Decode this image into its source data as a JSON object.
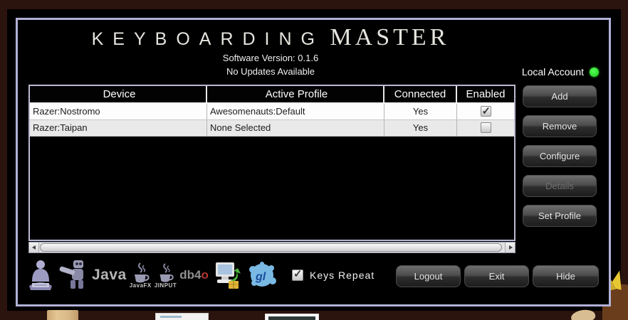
{
  "title": {
    "word1": "KEYBOARDING",
    "word2": "MASTER"
  },
  "status": {
    "version": "Software Version: 0.1.6",
    "updates": "No Updates Available",
    "account_label": "Local Account",
    "account_status_color": "#2ee62e"
  },
  "table": {
    "columns": [
      "Device",
      "Active Profile",
      "Connected",
      "Enabled"
    ],
    "rows": [
      {
        "device": "Razer:Nostromo",
        "active_profile": "Awesomenauts:Default",
        "connected": "Yes",
        "enabled": true
      },
      {
        "device": "Razer:Taipan",
        "active_profile": "None Selected",
        "connected": "Yes",
        "enabled": false
      }
    ]
  },
  "actions": {
    "add": "Add",
    "remove": "Remove",
    "configure": "Configure",
    "details": "Details",
    "set_profile": "Set Profile"
  },
  "footer": {
    "keys_repeat_label": "Keys Repeat",
    "keys_repeat_checked": true,
    "logout": "Logout",
    "exit": "Exit",
    "hide": "Hide",
    "icons": [
      {
        "name": "keyboard-guru-logo"
      },
      {
        "name": "robot-mascot-logo"
      },
      {
        "name": "java-logo",
        "label": "Java"
      },
      {
        "name": "javafx-logo",
        "label": "JavaFX"
      },
      {
        "name": "jinput-logo",
        "label": "JINPUT"
      },
      {
        "name": "db4o-logo",
        "label_gray": "db4",
        "label_red": "o"
      },
      {
        "name": "install-computer-logo"
      },
      {
        "name": "gl-splat-logo",
        "label": "gl"
      }
    ]
  },
  "colors": {
    "window_border": "#b2b1d6",
    "desktop_background": "#2b130e",
    "window_background": "#000000",
    "status_green": "#2ee62e"
  }
}
